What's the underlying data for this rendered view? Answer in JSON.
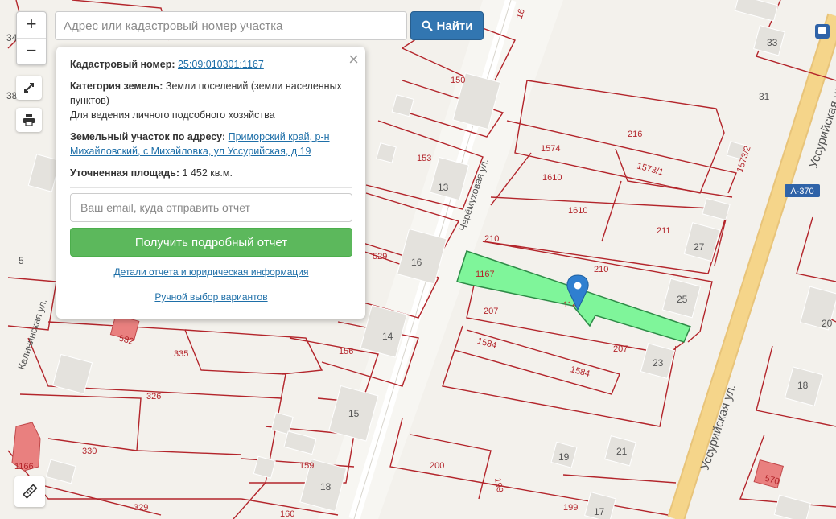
{
  "search": {
    "placeholder": "Адрес или кадастровый номер участка",
    "button_label": "Найти"
  },
  "zoom": {
    "in_label": "+",
    "out_label": "−"
  },
  "popup": {
    "cadastral_label": "Кадастровый номер:",
    "cadastral_value": "25:09:010301:1167",
    "category_label": "Категория земель:",
    "category_value": "Земли поселений (земли населенных пунктов)",
    "usage_value": "Для ведения личного подсобного хозяйства",
    "address_label": "Земельный участок по адресу:",
    "address_value": "Приморский край, р-н Михайловский, с Михайловка, ул Уссурийская, д 19",
    "area_label": "Уточненная площадь:",
    "area_value": "1 452 кв.м.",
    "email_placeholder": "Ваш email, куда отправить отчет",
    "report_button": "Получить подробный отчет",
    "details_link": "Детали отчета и юридическая информация",
    "manual_link": "Ручной выбор вариантов"
  },
  "map": {
    "highlight_color": "#7ff59a",
    "parcel_line_color": "#b3252b",
    "road_color": "#f5d58a",
    "streets": [
      "Черёмуховая ул.",
      "Калининская ул.",
      "Уссурийская ул.",
      "Уссурийская ул."
    ],
    "route_badge": "А-370",
    "parcel_labels": [
      "150",
      "16",
      "153",
      "216",
      "1574",
      "1573/1",
      "1573/2",
      "1610",
      "1610",
      "211",
      "210",
      "210",
      "1167",
      "207",
      "207",
      "1584",
      "1584",
      "529",
      "582",
      "335",
      "156",
      "326",
      "330",
      "159",
      "329",
      "160",
      "200",
      "199",
      "199",
      "570",
      "1166",
      "114"
    ],
    "house_numbers": [
      "33",
      "31",
      "13",
      "27",
      "16",
      "25",
      "14",
      "23",
      "18",
      "15",
      "19",
      "21",
      "18",
      "17",
      "20",
      "5",
      "34",
      "38"
    ]
  }
}
